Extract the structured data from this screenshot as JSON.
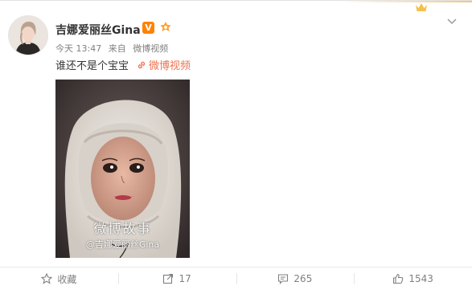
{
  "post": {
    "username": "吉娜爱丽丝Gina",
    "verified_badge": "V",
    "time": "今天 13:47",
    "source_prefix": "来自",
    "source": "微博视频",
    "text": "谁还不是个宝宝",
    "link_text": "微博视频"
  },
  "video": {
    "watermark_title": "微博故事",
    "watermark_user": "@吉娜爱丽丝Gina"
  },
  "actions": {
    "favorite_label": "收藏",
    "repost_count": "17",
    "comment_count": "265",
    "like_count": "1543"
  },
  "colors": {
    "link": "#eb7350",
    "verified": "#ff8200",
    "text": "#333333",
    "muted": "#808080"
  }
}
